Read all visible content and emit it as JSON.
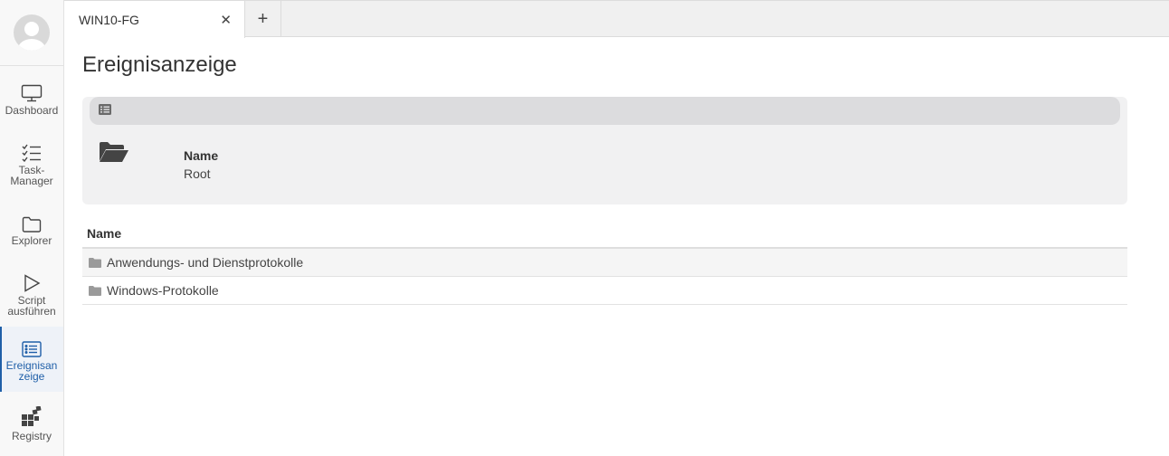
{
  "sidebar": {
    "items": [
      {
        "label": "Dashboard",
        "icon": "monitor-icon",
        "active": false
      },
      {
        "label": "Task-\nManager",
        "icon": "checklist-icon",
        "active": false
      },
      {
        "label": "Explorer",
        "icon": "folder-icon",
        "active": false
      },
      {
        "label": "Script\nausführen",
        "icon": "play-icon",
        "active": false
      },
      {
        "label": "Ereignisan\nzeige",
        "icon": "event-list-icon",
        "active": true
      },
      {
        "label": "Registry",
        "icon": "registry-blocks-icon",
        "active": false
      }
    ]
  },
  "tabs": {
    "active_label": "WIN10-FG",
    "close_glyph": "✕",
    "add_glyph": "+"
  },
  "main": {
    "title": "Ereignisanzeige",
    "info": {
      "label": "Name",
      "value": "Root"
    },
    "table": {
      "header": "Name",
      "rows": [
        {
          "name": "Anwendungs- und Dienstprotokolle"
        },
        {
          "name": "Windows-Protokolle"
        }
      ]
    }
  },
  "colors": {
    "accent": "#1f5fa8",
    "panel": "#f1f1f2",
    "toolbar": "#dcdcde"
  }
}
